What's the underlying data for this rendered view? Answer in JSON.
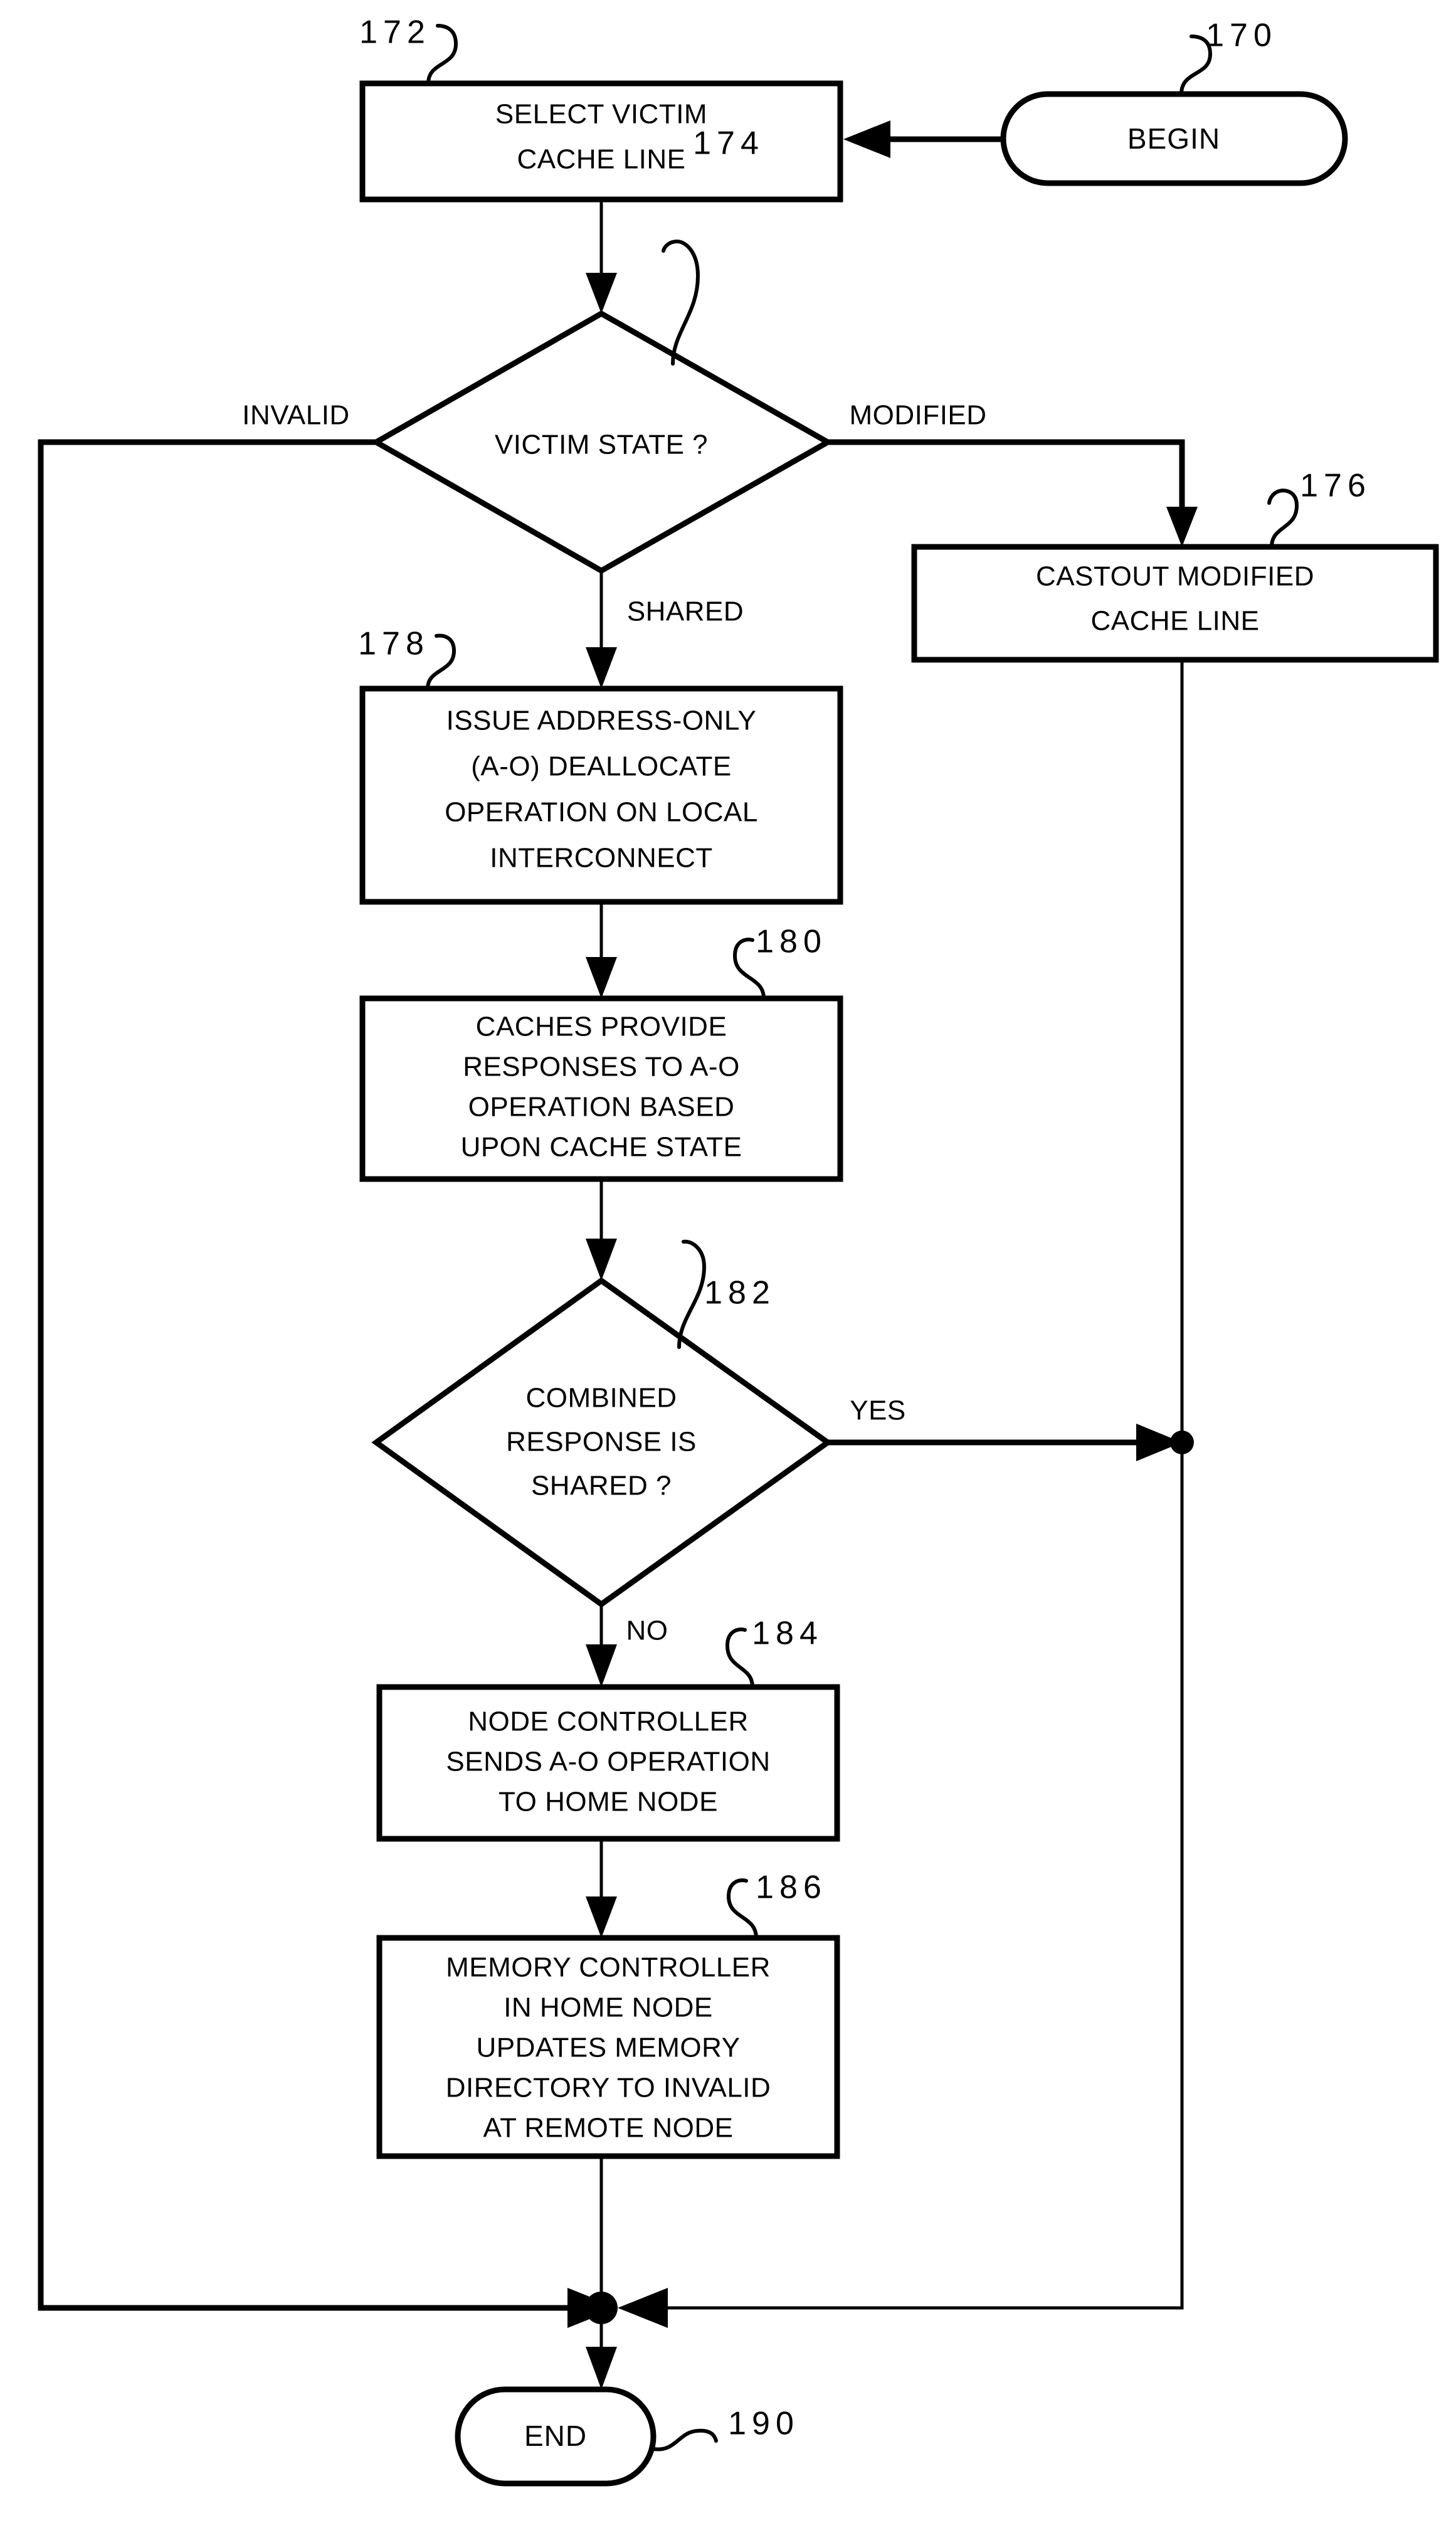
{
  "figure": {
    "type": "flowchart",
    "orientation": "vertical",
    "nodes": {
      "begin": {
        "ref": "170",
        "label": "BEGIN",
        "shape": "terminator"
      },
      "select_victim": {
        "ref": "172",
        "line1": "SELECT VICTIM",
        "line2": "CACHE LINE",
        "shape": "process"
      },
      "victim_state": {
        "ref": "174",
        "label": "VICTIM STATE ?",
        "shape": "decision"
      },
      "castout": {
        "ref": "176",
        "line1": "CASTOUT MODIFIED",
        "line2": "CACHE LINE",
        "shape": "process"
      },
      "issue_ao": {
        "ref": "178",
        "line1": "ISSUE ADDRESS-ONLY",
        "line2": "(A-O) DEALLOCATE",
        "line3": "OPERATION ON LOCAL",
        "line4": "INTERCONNECT",
        "shape": "process"
      },
      "caches_respond": {
        "ref": "180",
        "line1": "CACHES PROVIDE",
        "line2": "RESPONSES TO A-O",
        "line3": "OPERATION BASED",
        "line4": "UPON CACHE STATE",
        "shape": "process"
      },
      "combined_response": {
        "ref": "182",
        "line1": "COMBINED",
        "line2": "RESPONSE IS",
        "line3": "SHARED ?",
        "shape": "decision"
      },
      "node_controller": {
        "ref": "184",
        "line1": "NODE CONTROLLER",
        "line2": "SENDS A-O OPERATION",
        "line3": "TO HOME NODE",
        "shape": "process"
      },
      "memory_controller": {
        "ref": "186",
        "line1": "MEMORY CONTROLLER",
        "line2": "IN HOME NODE",
        "line3": "UPDATES MEMORY",
        "line4": "DIRECTORY TO INVALID",
        "line5": "AT REMOTE NODE",
        "shape": "process"
      },
      "end": {
        "ref": "190",
        "label": "END",
        "shape": "terminator"
      }
    },
    "edge_labels": {
      "invalid": "INVALID",
      "modified": "MODIFIED",
      "shared": "SHARED",
      "yes": "YES",
      "no": "NO"
    },
    "colors": {
      "stroke": "#000000",
      "fill": "#ffffff",
      "background": "#ffffff"
    }
  }
}
